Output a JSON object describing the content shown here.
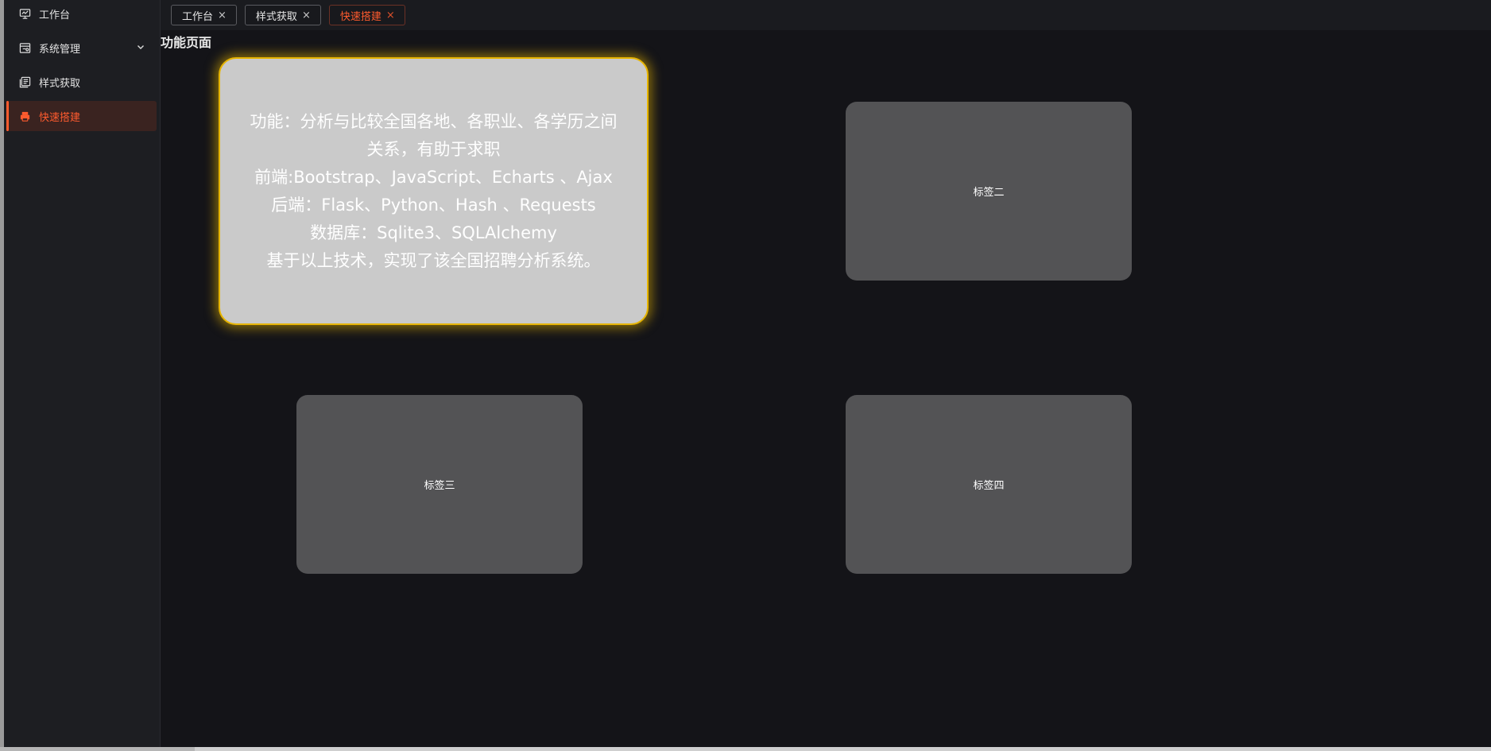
{
  "sidebar": {
    "items": [
      {
        "label": "工作台",
        "icon": "monitor-icon",
        "active": false
      },
      {
        "label": "系统管理",
        "icon": "settings-panel-icon",
        "active": false,
        "expandable": true
      },
      {
        "label": "样式获取",
        "icon": "book-icon",
        "active": false
      },
      {
        "label": "快速搭建",
        "icon": "build-icon",
        "active": true
      }
    ]
  },
  "tabs": [
    {
      "label": "工作台",
      "close": "×",
      "active": false
    },
    {
      "label": "样式获取",
      "close": "×",
      "active": false
    },
    {
      "label": "快速搭建",
      "close": "×",
      "active": true
    }
  ],
  "page": {
    "title": "功能页面"
  },
  "cards": {
    "featured": {
      "lines": [
        "功能：分析与比较全国各地、各职业、各学历之间",
        "关系，有助于求职",
        "前端:Bootstrap、JavaScript、Echarts 、Ajax",
        "后端：Flask、Python、Hash 、Requests",
        "数据库：Sqlite3、SQLAlchemy",
        "基于以上技术，实现了该全国招聘分析系统。"
      ]
    },
    "tag2": "标签二",
    "tag3": "标签三",
    "tag4": "标签四"
  },
  "colors": {
    "accent": "#ff5b2e",
    "background": "#141418",
    "sidebar": "#1d1e22",
    "card": "#535355",
    "featured_card": "#cacaca",
    "featured_border": "#e6b400"
  }
}
